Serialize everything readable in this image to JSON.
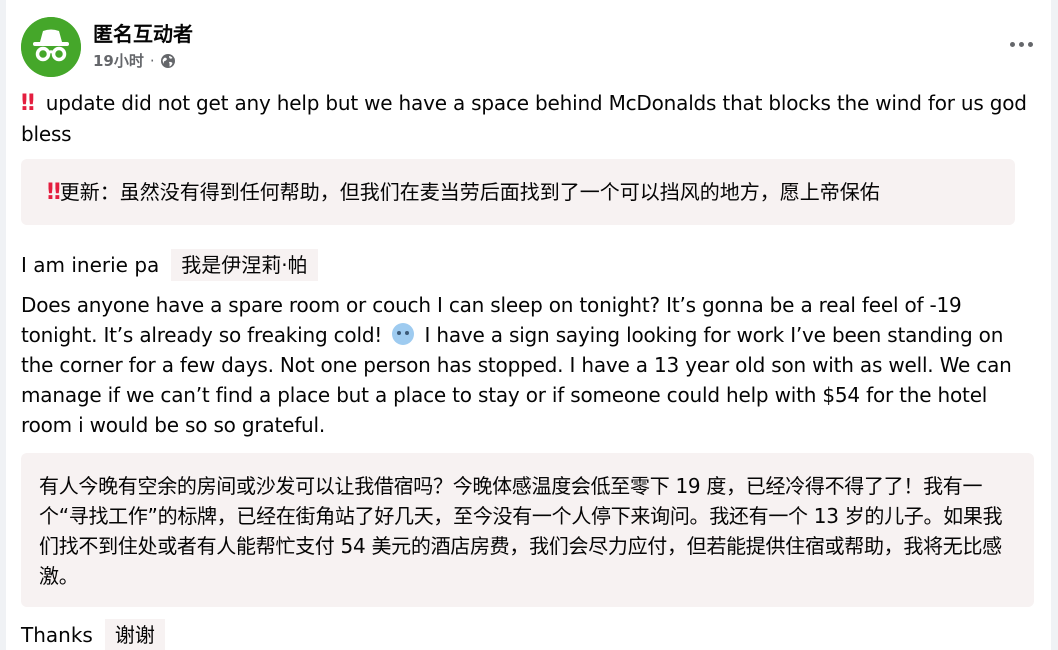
{
  "post": {
    "author": "匿名互动者",
    "time": "19小时",
    "separator": "·",
    "menu_label": "...",
    "icons": {
      "avatar": "anonymous-incognito-avatar",
      "privacy": "globe-icon",
      "alert": "double-exclamation-icon",
      "emoji": "cold-face-emoji"
    },
    "colors": {
      "avatar_bg": "#45a72a",
      "alert": "#e41e3f",
      "translation_bg": "#f7f2f2",
      "meta_text": "#65676b"
    }
  },
  "content": {
    "bang": "‼",
    "update_text": "update  did not get any help but we  have a space behind McDonalds that blocks the wind for us god bless",
    "update_translation": "更新：虽然没有得到任何帮助，但我们在麦当劳后面找到了一个可以挡风的地方，愿上帝保佑",
    "intro_text": "I am inerie pa",
    "intro_translation": "我是伊涅莉·帕",
    "request_text_part1": "Does anyone have a spare room or couch I can sleep on tonight? It’s gonna be a real feel of -19 tonight. It’s already so freaking cold!",
    "request_text_part2": "I have a sign saying looking for work I’ve been standing on the corner for a few days. Not one person has stopped. I have a 13 year old son with as well. We can manage if we can’t find a place but a place to stay or if someone could help with $54 for the hotel room i would  be so so grateful.",
    "request_translation": "有人今晚有空余的房间或沙发可以让我借宿吗？今晚体感温度会低至零下 19 度，已经冷得不得了了！我有一个“寻找工作”的标牌，已经在街角站了好几天，至今没有一个人停下来询问。我还有一个 13 岁的儿子。如果我们找不到住处或者有人能帮忙支付 54 美元的酒店房费，我们会尽力应付，但若能提供住宿或帮助，我将无比感激。",
    "thanks_text": "Thanks",
    "thanks_translation": "谢谢"
  }
}
